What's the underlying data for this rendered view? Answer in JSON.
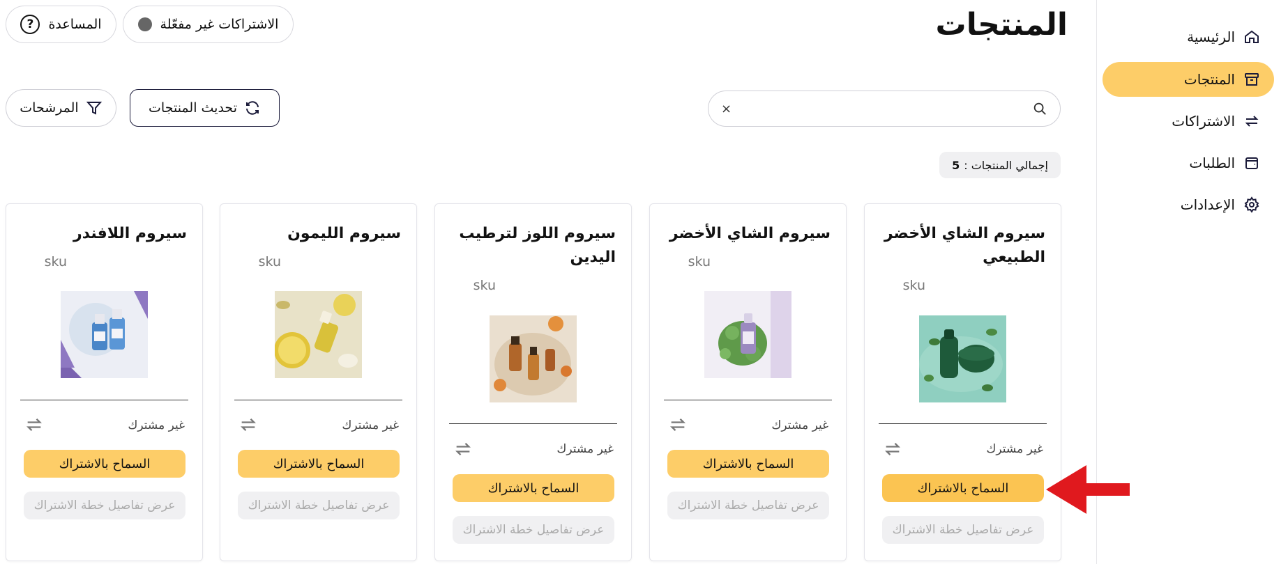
{
  "sidebar": {
    "items": [
      {
        "label": "الرئيسية",
        "icon": "home-icon"
      },
      {
        "label": "المنتجات",
        "icon": "archive-box-icon",
        "active": true
      },
      {
        "label": "الاشتراكات",
        "icon": "arrows-exchange-icon"
      },
      {
        "label": "الطلبات",
        "icon": "wallet-icon"
      },
      {
        "label": "الإعدادات",
        "icon": "gear-icon"
      }
    ]
  },
  "header": {
    "title": "المنتجات",
    "subscriptions_status": "الاشتراكات غير مفعّلة",
    "help": "المساعدة"
  },
  "toolbar": {
    "search_placeholder": "",
    "clear": "×",
    "refresh": "تحديث المنتجات",
    "filters": "المرشحات"
  },
  "summary": {
    "total_label": "إجمالي المنتجات :",
    "total_count": "5"
  },
  "products": [
    {
      "name": "سيروم الشاي الأخضر الطبيعي",
      "sku": "sku",
      "status": "غير مشترك",
      "allow": "السماح بالاشتراك",
      "plan": "عرض تفاصيل خطة الاشتراك",
      "image": "green-tea-serum-photo"
    },
    {
      "name": "سيروم الشاي الأخضر",
      "sku": "sku",
      "status": "غير مشترك",
      "allow": "السماح بالاشتراك",
      "plan": "عرض تفاصيل خطة الاشتراك",
      "image": "lavender-bottle-moss-photo"
    },
    {
      "name": "سيروم اللوز لترطيب اليدين",
      "sku": "sku",
      "status": "غير مشترك",
      "allow": "السماح بالاشتراك",
      "plan": "عرض تفاصيل خطة الاشتراك",
      "image": "amber-dropper-bottles-photo"
    },
    {
      "name": "سيروم الليمون",
      "sku": "sku",
      "status": "غير مشترك",
      "allow": "السماح بالاشتراك",
      "plan": "عرض تفاصيل خطة الاشتراك",
      "image": "lemon-serum-photo"
    },
    {
      "name": "سيروم اللافندر",
      "sku": "sku",
      "status": "غير مشترك",
      "allow": "السماح بالاشتراك",
      "plan": "عرض تفاصيل خطة الاشتراك",
      "image": "lavender-serum-photo"
    }
  ],
  "colors": {
    "accent": "#fdcd68",
    "annotation_arrow": "#e0191e"
  }
}
